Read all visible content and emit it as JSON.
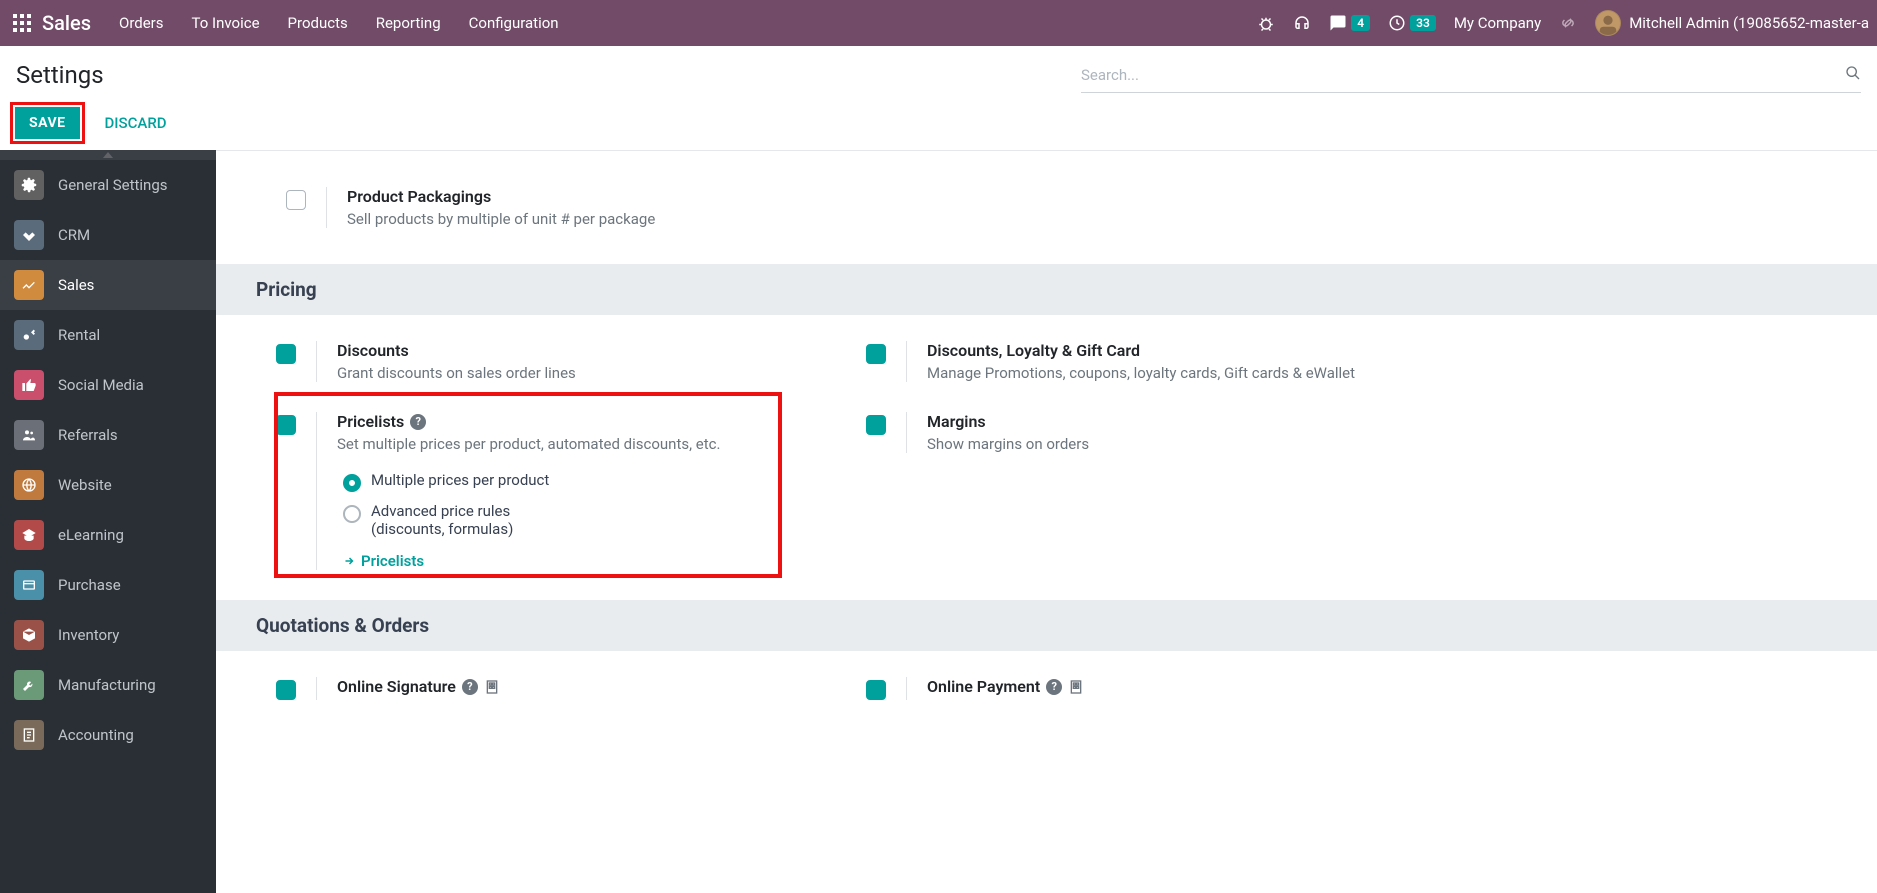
{
  "topbar": {
    "brand": "Sales",
    "nav": [
      "Orders",
      "To Invoice",
      "Products",
      "Reporting",
      "Configuration"
    ],
    "messaging_badge": "4",
    "activities_badge": "33",
    "company": "My Company",
    "user": "Mitchell Admin (19085652-master-a"
  },
  "page": {
    "title": "Settings",
    "search_placeholder": "Search...",
    "save_label": "SAVE",
    "discard_label": "DISCARD"
  },
  "sidebar": {
    "items": [
      "General Settings",
      "CRM",
      "Sales",
      "Rental",
      "Social Media",
      "Referrals",
      "Website",
      "eLearning",
      "Purchase",
      "Inventory",
      "Manufacturing",
      "Accounting"
    ]
  },
  "sections": {
    "product_packagings": {
      "title": "Product Packagings",
      "desc": "Sell products by multiple of unit # per package"
    },
    "pricing_header": "Pricing",
    "discounts": {
      "title": "Discounts",
      "desc": "Grant discounts on sales order lines"
    },
    "loyalty": {
      "title": "Discounts, Loyalty & Gift Card",
      "desc": "Manage Promotions, coupons, loyalty cards, Gift cards & eWallet"
    },
    "pricelists": {
      "title": "Pricelists",
      "desc": "Set multiple prices per product, automated discounts, etc.",
      "radio1": "Multiple prices per product",
      "radio2a": "Advanced price rules",
      "radio2b": "(discounts, formulas)",
      "link": "Pricelists"
    },
    "margins": {
      "title": "Margins",
      "desc": "Show margins on orders"
    },
    "quotations_header": "Quotations & Orders",
    "online_signature": {
      "title": "Online Signature"
    },
    "online_payment": {
      "title": "Online Payment"
    }
  }
}
